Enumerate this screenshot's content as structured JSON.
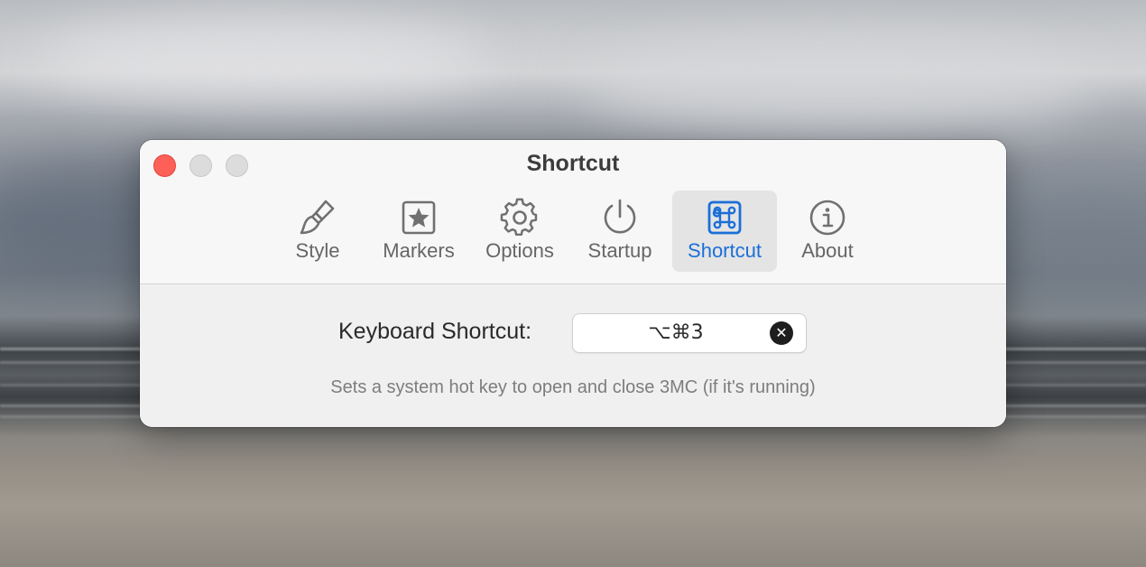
{
  "window": {
    "title": "Shortcut"
  },
  "tabs": [
    {
      "label": "Style",
      "icon": "paintbrush-icon"
    },
    {
      "label": "Markers",
      "icon": "star-square-icon"
    },
    {
      "label": "Options",
      "icon": "gear-icon"
    },
    {
      "label": "Startup",
      "icon": "power-icon"
    },
    {
      "label": "Shortcut",
      "icon": "command-key-icon",
      "selected": true
    },
    {
      "label": "About",
      "icon": "info-circle-icon"
    }
  ],
  "shortcut": {
    "label": "Keyboard Shortcut:",
    "value": "⌥⌘3",
    "clear_symbol": "✕",
    "hint": "Sets a system hot key to open and close 3MC (if it's running)"
  },
  "colors": {
    "accent": "#1a6fd8",
    "close_button": "#fe5f57",
    "inactive_traffic": "#dcdcdc"
  }
}
